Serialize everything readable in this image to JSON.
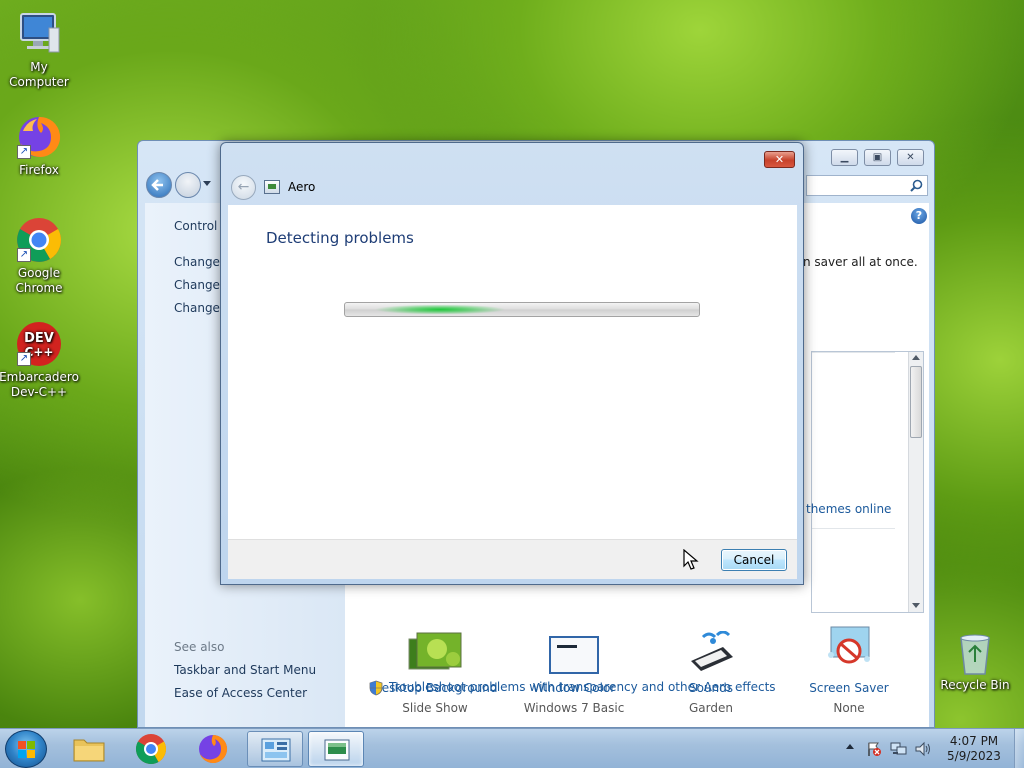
{
  "desktop": {
    "icons": [
      {
        "label": "My Computer"
      },
      {
        "label": "Firefox"
      },
      {
        "label": "Google Chrome"
      },
      {
        "label": "Embarcadero Dev-C++"
      },
      {
        "label": "Recycle Bin"
      }
    ]
  },
  "control_panel": {
    "left_links": [
      "Control P",
      "Change d",
      "Change m",
      "Change y"
    ],
    "see_also_title": "See also",
    "see_also_links": [
      "Taskbar and Start Menu",
      "Ease of Access Center"
    ],
    "description_fragment": "n saver all at once.",
    "themes_online_fragment": "themes online",
    "settings": [
      {
        "title": "Desktop Background",
        "value": "Slide Show"
      },
      {
        "title": "Window Color",
        "value": "Windows 7 Basic"
      },
      {
        "title": "Sounds",
        "value": "Garden"
      },
      {
        "title": "Screen Saver",
        "value": "None"
      }
    ],
    "troubleshoot_link": "Troubleshoot problems with transparency and other Aero effects"
  },
  "dialog": {
    "title": "Aero",
    "heading": "Detecting problems",
    "cancel_label": "Cancel",
    "close_glyph": "✕"
  },
  "taskbar": {
    "time": "4:07 PM",
    "date": "5/9/2023"
  },
  "colors": {
    "link": "#1c5a9c",
    "heading": "#1e3d76",
    "progress_glow": "#1fc83a"
  }
}
